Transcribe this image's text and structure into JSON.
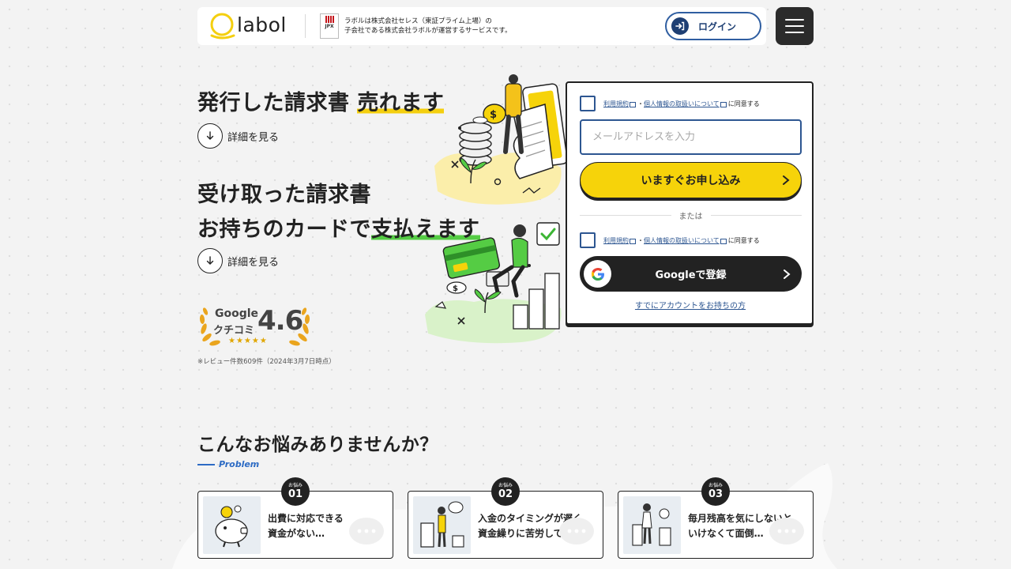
{
  "header": {
    "logo_text": "labol",
    "jpx_label": "JPX",
    "company_note_line1": "ラボルは株式会社セレス（東証プライム上場）の",
    "company_note_line2": "子会社である株式会社ラボルが運営するサービスです。",
    "login_label": "ログイン"
  },
  "hero": {
    "headline1_plain": "発行した請求書 ",
    "headline1_highlight": "売れます",
    "detail1_label": "詳細を見る",
    "headline2_line1": "受け取った請求書",
    "headline2_plain": "お持ちのカードで",
    "headline2_highlight": "支払えます",
    "detail2_label": "詳細を見る",
    "rating_google": "Google",
    "rating_kuchikomi": "クチコミ",
    "rating_score": "4.6",
    "rating_stars": "★★★★★",
    "review_note": "※レビュー件数609件（2024年3月7日時点）"
  },
  "signup": {
    "terms_link": "利用規約",
    "separator": "・",
    "privacy_link": "個人情報の取扱いについて",
    "agree_suffix": "に同意する",
    "email_placeholder": "メールアドレスを入力",
    "apply_label": "いますぐお申し込み",
    "or_label": "または",
    "google_label": "Googleで登録",
    "account_link": "すでにアカウントをお持ちの方"
  },
  "problems": {
    "title": "こんなお悩みありませんか？",
    "subtitle": "Problem",
    "badge_top": "お悩み",
    "items": [
      {
        "num": "01",
        "line1": "出費に対応できる",
        "line2": "資金がない…"
      },
      {
        "num": "02",
        "line1": "入金のタイミングが遅く、",
        "line2": "資金繰りに苦労している…"
      },
      {
        "num": "03",
        "line1": "毎月残高を気にしないと",
        "line2": "いけなくて面倒…"
      }
    ]
  },
  "colors": {
    "brand_yellow": "#f6d30a",
    "brand_navy": "#2d5691",
    "accent_green": "#55cc44",
    "dark": "#222222"
  }
}
